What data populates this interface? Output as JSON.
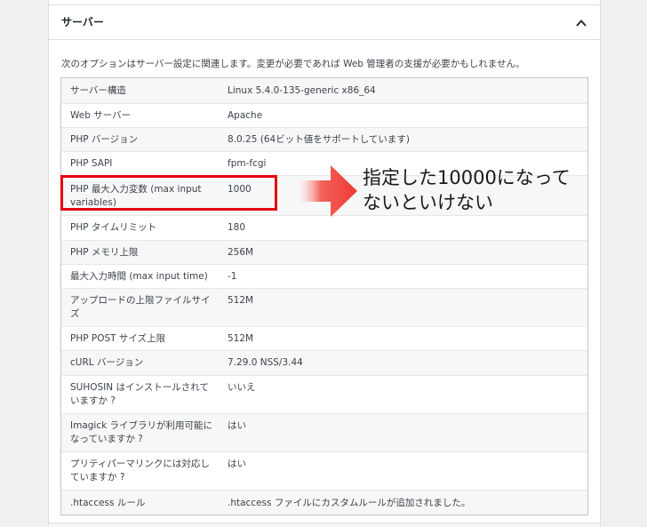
{
  "section": {
    "title": "サーバー",
    "description": "次のオプションはサーバー設定に関連します。変更が必要であれば Web 管理者の支援が必要かもしれません。"
  },
  "rows": [
    {
      "label": "サーバー構造",
      "value": "Linux 5.4.0-135-generic x86_64"
    },
    {
      "label": "Web サーバー",
      "value": "Apache"
    },
    {
      "label": "PHP バージョン",
      "value": "8.0.25 (64ビット値をサポートしています)"
    },
    {
      "label": "PHP SAPI",
      "value": "fpm-fcgi"
    },
    {
      "label": "PHP 最大入力変数 (max input variables)",
      "value": "1000"
    },
    {
      "label": "PHP タイムリミット",
      "value": "180"
    },
    {
      "label": "PHP メモリ上限",
      "value": "256M"
    },
    {
      "label": "最大入力時間 (max input time)",
      "value": "-1"
    },
    {
      "label": "アップロードの上限ファイルサイズ",
      "value": "512M"
    },
    {
      "label": "PHP POST サイズ上限",
      "value": "512M"
    },
    {
      "label": "cURL バージョン",
      "value": "7.29.0 NSS/3.44"
    },
    {
      "label": "SUHOSIN はインストールされていますか ?",
      "value": "いいえ"
    },
    {
      "label": "Imagick ライブラリが利用可能になっていますか ?",
      "value": "はい"
    },
    {
      "label": "プリティパーマリンクには対応していますか ?",
      "value": "はい"
    },
    {
      "label": ".htaccess ルール",
      "value": ".htaccess ファイルにカスタムルールが追加されました。"
    }
  ],
  "annotation": {
    "line1": "指定した10000になって",
    "line2": "ないといけない",
    "box_color": "#e60012",
    "arrow_color": "#ee3a32"
  }
}
